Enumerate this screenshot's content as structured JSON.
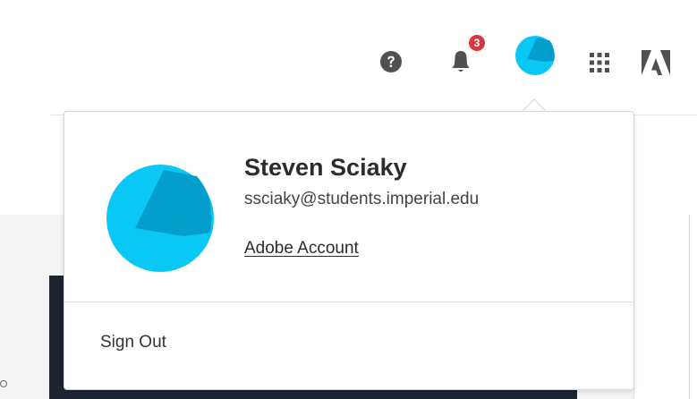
{
  "header": {
    "notification_count": "3",
    "icons": [
      "help-icon",
      "bell-icon",
      "avatar",
      "apps-grid-icon",
      "adobe-logo"
    ]
  },
  "colors": {
    "avatar_light": "#0ac8f6",
    "avatar_dark": "#039ecb",
    "badge": "#d7373f",
    "text": "#2c2c2c",
    "help_icon": "#505050"
  },
  "account_menu": {
    "name": "Steven Sciaky",
    "email": "ssciaky@students.imperial.edu",
    "account_link": "Adobe Account",
    "sign_out": "Sign Out"
  }
}
